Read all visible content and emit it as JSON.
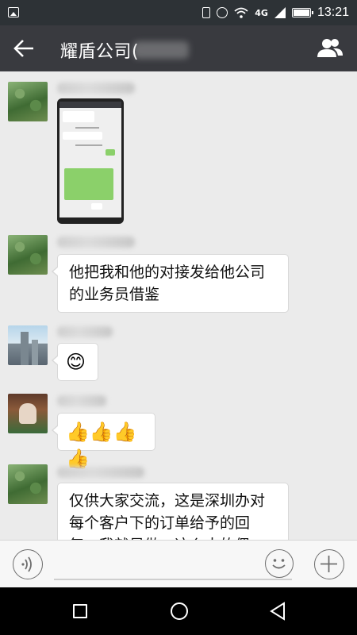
{
  "status_bar": {
    "network": "4G",
    "time": "13:21"
  },
  "header": {
    "title": "耀盾公司("
  },
  "messages": [
    {
      "type": "image"
    },
    {
      "type": "text",
      "text": "他把我和他的对接发给他公司的业务员借鉴"
    },
    {
      "type": "text",
      "text": "😊"
    },
    {
      "type": "text",
      "text": "👍👍👍👍"
    },
    {
      "type": "text",
      "text": "仅供大家交流，这是深圳办对每个客户下的订单给予的回复，我就是做一这么大的偶"
    }
  ],
  "nav": {}
}
